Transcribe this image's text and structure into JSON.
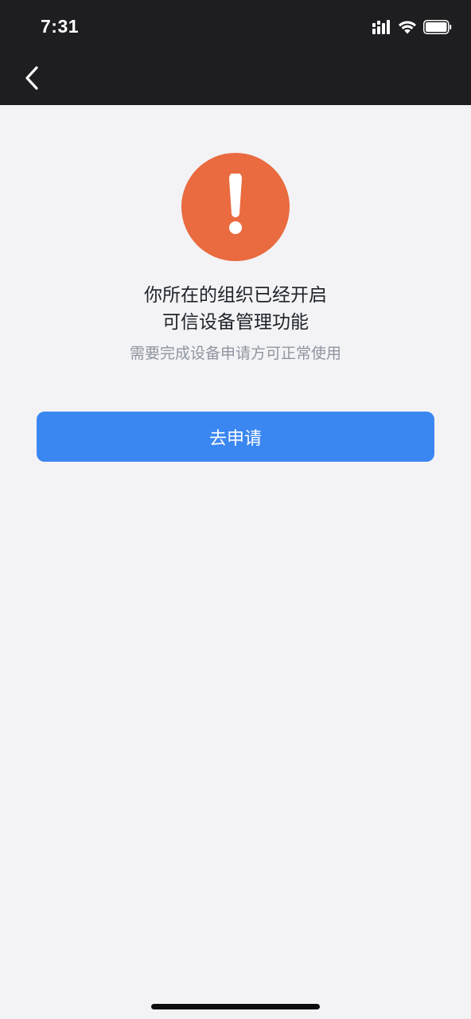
{
  "status_bar": {
    "time": "7:31",
    "icons": [
      "signal-icon",
      "wifi-icon",
      "battery-icon"
    ]
  },
  "nav": {
    "back_icon": "chevron-left-icon"
  },
  "alert": {
    "icon": "exclamation-icon",
    "color": "#e96b3f",
    "title_line1": "你所在的组织已经开启",
    "title_line2": "可信设备管理功能",
    "subtitle": "需要完成设备申请方可正常使用"
  },
  "actions": {
    "apply_label": "去申请",
    "apply_color": "#3b87f2"
  }
}
